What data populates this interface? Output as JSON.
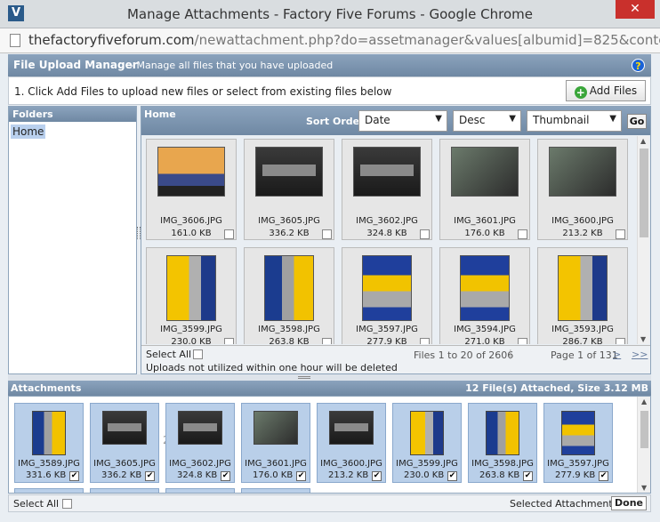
{
  "window": {
    "title": "Manage Attachments - Factory Five Forums - Google Chrome",
    "close_glyph": "✕",
    "app_icon_glyph": "V"
  },
  "address": {
    "domain": "thefactoryfiveforum.com",
    "path": "/newattachment.php?do=assetmanager&values[albumid]=825&contentty"
  },
  "header": {
    "title": "File Upload Manager",
    "subtitle": "- Manage all files that you have uploaded",
    "help_glyph": "?"
  },
  "toolbar": {
    "instruction": "1. Click Add Files to upload new files or select from existing files below",
    "add_files_label": "Add Files",
    "add_glyph": "+"
  },
  "folders": {
    "title": "Folders",
    "items": [
      "Home"
    ]
  },
  "files": {
    "breadcrumb": "Home",
    "sort_label": "Sort Order:",
    "sort_field": "Date",
    "sort_direction": "Desc",
    "view_mode": "Thumbnail",
    "dropdown_glyph": "▼",
    "go_label": "Go",
    "items": [
      {
        "name": "IMG_3606.JPG",
        "size": "161.0 KB",
        "photo": "orange"
      },
      {
        "name": "IMG_3605.JPG",
        "size": "336.2 KB",
        "photo": "under"
      },
      {
        "name": "IMG_3602.JPG",
        "size": "324.8 KB",
        "photo": "under"
      },
      {
        "name": "IMG_3601.JPG",
        "size": "176.0 KB",
        "photo": "grey"
      },
      {
        "name": "IMG_3600.JPG",
        "size": "213.2 KB",
        "photo": "grey"
      },
      {
        "name": "IMG_3599.JPG",
        "size": "230.0 KB",
        "photo": "yellow"
      },
      {
        "name": "IMG_3598.JPG",
        "size": "263.8 KB",
        "photo": "yellow3"
      },
      {
        "name": "IMG_3597.JPG",
        "size": "277.9 KB",
        "photo": "yellow2"
      },
      {
        "name": "IMG_3594.JPG",
        "size": "271.0 KB",
        "photo": "yellow2"
      },
      {
        "name": "IMG_3593.JPG",
        "size": "286.7 KB",
        "photo": "yellow"
      }
    ],
    "select_all_label": "Select All",
    "range_text": "Files 1 to 20 of 2606",
    "separator": "|",
    "page_text": "Page 1 of 131",
    "next_label": ">",
    "last_label": ">>",
    "note": "Uploads not utilized within one hour will be deleted"
  },
  "attachments": {
    "title": "Attachments",
    "summary": "12 File(s) Attached, Size 3.12 MB",
    "ghost_text": "2",
    "check_glyph": "✔",
    "items": [
      {
        "name": "IMG_3589.JPG",
        "size": "331.6 KB",
        "photo": "yellow3"
      },
      {
        "name": "IMG_3605.JPG",
        "size": "336.2 KB",
        "photo": "under"
      },
      {
        "name": "IMG_3602.JPG",
        "size": "324.8 KB",
        "photo": "under"
      },
      {
        "name": "IMG_3601.JPG",
        "size": "176.0 KB",
        "photo": "grey"
      },
      {
        "name": "IMG_3600.JPG",
        "size": "213.2 KB",
        "photo": "under"
      },
      {
        "name": "IMG_3599.JPG",
        "size": "230.0 KB",
        "photo": "yellow"
      },
      {
        "name": "IMG_3598.JPG",
        "size": "263.8 KB",
        "photo": "yellow3"
      },
      {
        "name": "IMG_3597.JPG",
        "size": "277.9 KB",
        "photo": "yellow2"
      }
    ],
    "select_all_label": "Select All",
    "selected_label": "Selected Attachments:",
    "done_label": "Done"
  },
  "scroll": {
    "up_glyph": "▲",
    "down_glyph": "▼"
  }
}
